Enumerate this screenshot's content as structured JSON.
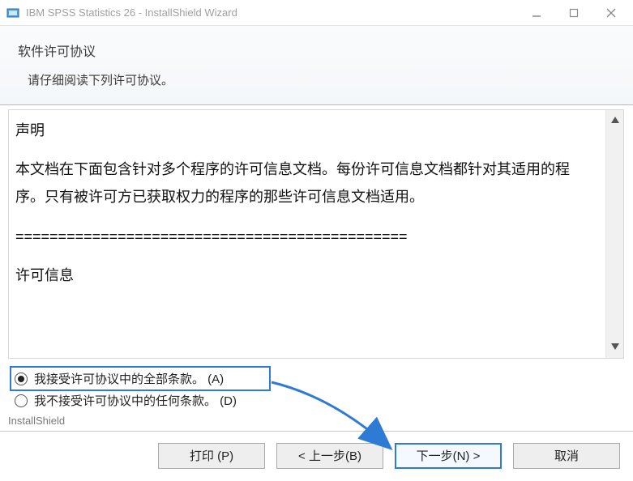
{
  "window": {
    "title": "IBM SPSS Statistics 26 - InstallShield Wizard"
  },
  "header": {
    "title": "软件许可协议",
    "subtitle": "请仔细阅读下列许可协议。"
  },
  "license": {
    "p1": "声明",
    "p2": "本文档在下面包含针对多个程序的许可信息文档。每份许可信息文档都针对其适用的程序。只有被许可方已获取权力的程序的那些许可信息文档适用。",
    "sep": "==============================================",
    "p3": "许可信息"
  },
  "radios": {
    "accept": "我接受许可协议中的全部条款。 (A)",
    "decline": "我不接受许可协议中的任何条款。 (D)"
  },
  "brand": "InstallShield",
  "buttons": {
    "print": "打印 (P)",
    "back": "< 上一步(B)",
    "next": "下一步(N) >",
    "cancel": "取消"
  }
}
